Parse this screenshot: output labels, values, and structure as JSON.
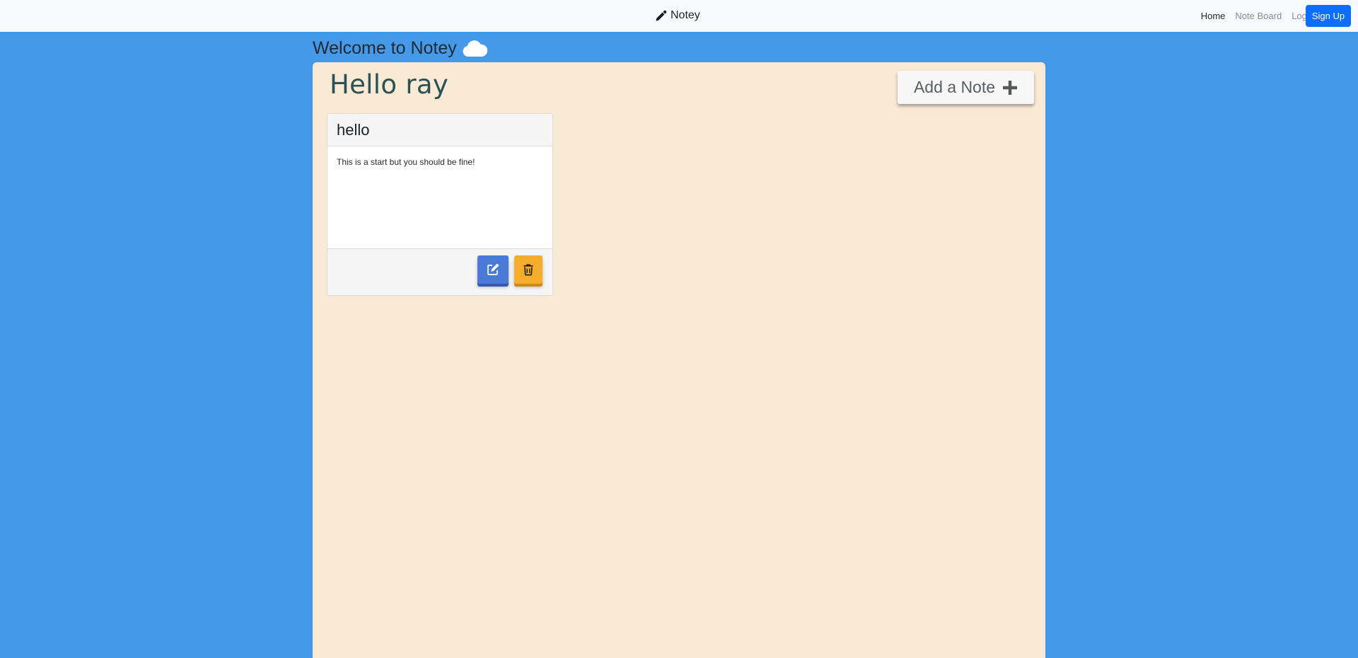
{
  "navbar": {
    "brand": "Notey",
    "brand_icon": "pencil-icon",
    "links": [
      {
        "label": "Home",
        "active": true
      },
      {
        "label": "Note Board",
        "active": false
      },
      {
        "label": "Login",
        "active": false
      }
    ],
    "signup_label": "Sign Up"
  },
  "welcome": {
    "title": "Welcome to Notey",
    "icon": "cloud-icon"
  },
  "board": {
    "greeting": "Hello ray",
    "add_note_label": "Add a Note",
    "add_note_icon": "plus-icon"
  },
  "notes": [
    {
      "title": "hello",
      "body": "This is a start but you should be fine!",
      "edit_icon": "edit-icon",
      "delete_icon": "trash-icon"
    }
  ],
  "colors": {
    "page_background": "#4699e8",
    "board_background": "#f9ead6",
    "navbar_background": "#f8f9fa",
    "signup_button": "#0d6efd",
    "edit_button": "#4a7ad6",
    "delete_button": "#f7ad2c",
    "greeting_text": "#2b5155"
  }
}
